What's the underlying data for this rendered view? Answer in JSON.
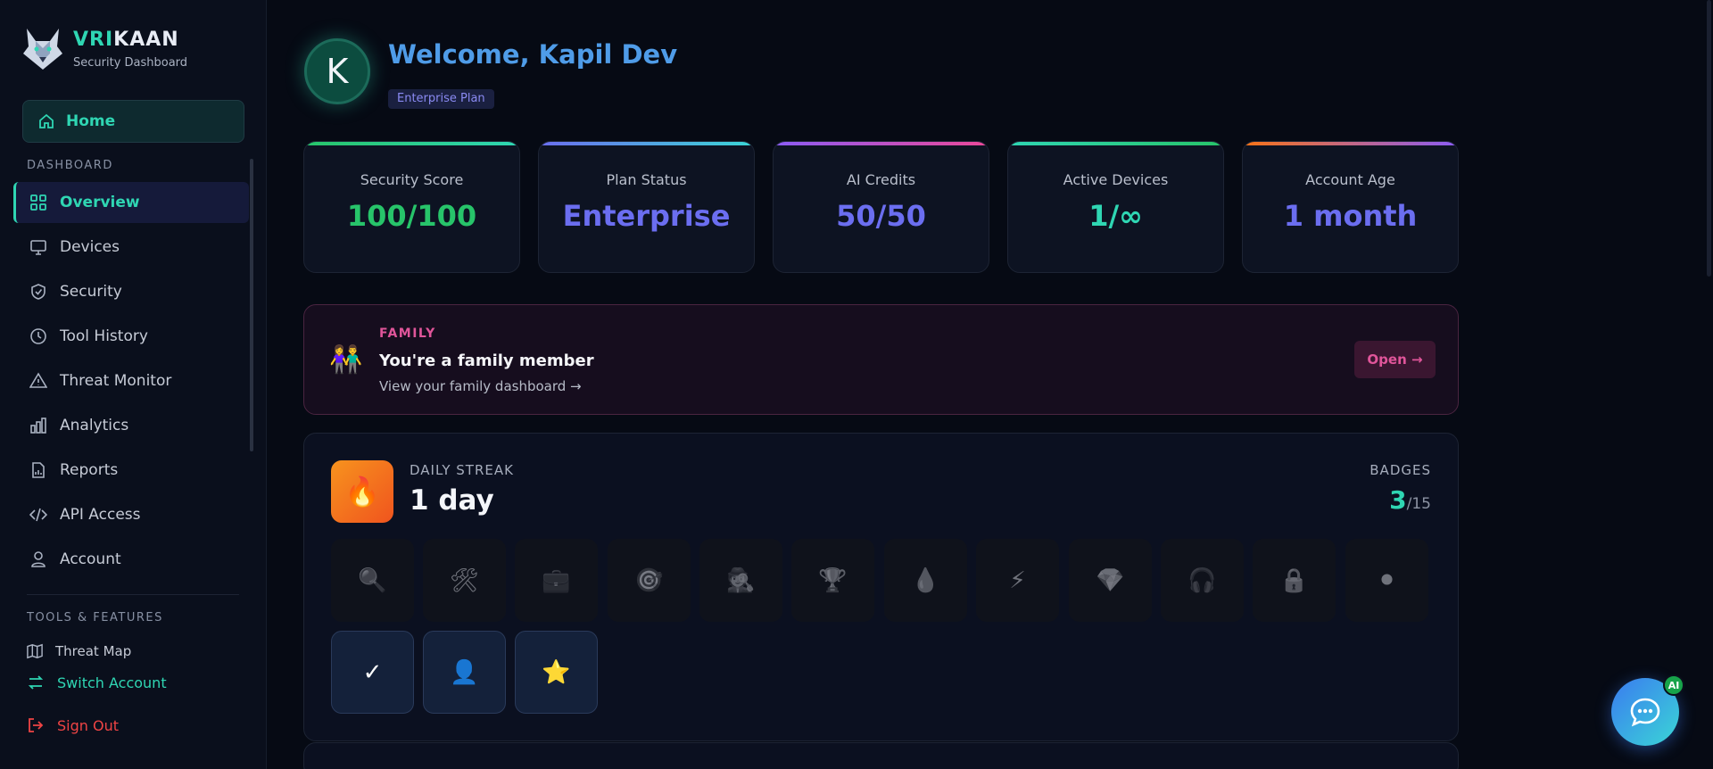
{
  "brand": {
    "name_accent": "VRI",
    "name_rest": "KAAN",
    "subtitle": "Security Dashboard"
  },
  "sidebar": {
    "home_label": "Home",
    "dashboard_section": "DASHBOARD",
    "items": [
      {
        "label": "Overview",
        "icon": "grid-icon",
        "active": true
      },
      {
        "label": "Devices",
        "icon": "monitor-icon"
      },
      {
        "label": "Security",
        "icon": "shield-check-icon"
      },
      {
        "label": "Tool History",
        "icon": "clock-icon"
      },
      {
        "label": "Threat Monitor",
        "icon": "warning-icon"
      },
      {
        "label": "Analytics",
        "icon": "bar-chart-icon"
      },
      {
        "label": "Reports",
        "icon": "report-icon"
      },
      {
        "label": "API Access",
        "icon": "code-icon"
      },
      {
        "label": "Account",
        "icon": "user-icon"
      }
    ],
    "tools_section": "TOOLS & FEATURES",
    "threat_map": "Threat Map",
    "switch_account": "Switch Account",
    "sign_out": "Sign Out"
  },
  "header": {
    "avatar_initial": "K",
    "welcome": "Welcome, Kapil Dev",
    "plan_badge": "Enterprise Plan"
  },
  "stats": [
    {
      "title": "Security Score",
      "value": "100/100",
      "color": "#27c46a",
      "bar": "linear-gradient(90deg,#27c46a,#2fd6b3)"
    },
    {
      "title": "Plan Status",
      "value": "Enterprise",
      "color": "#6b6ef0",
      "bar": "linear-gradient(90deg,#6b6ef0,#3ad6d6)"
    },
    {
      "title": "AI Credits",
      "value": "50/50",
      "color": "#6b6ef0",
      "bar": "linear-gradient(90deg,#8b5cf6,#ec4899)"
    },
    {
      "title": "Active Devices",
      "value": "1/∞",
      "color": "#2fd6b3",
      "bar": "linear-gradient(90deg,#2fd6b3,#27c46a)"
    },
    {
      "title": "Account Age",
      "value": "1 month",
      "color": "#6b6ef0",
      "bar": "linear-gradient(90deg,#f97316,#8b5cf6)"
    }
  ],
  "family": {
    "tag": "FAMILY",
    "heading": "You're a family member",
    "link": "View your family dashboard →",
    "open_label": "Open →",
    "emoji": "👫"
  },
  "streak": {
    "label": "DAILY STREAK",
    "value": "1 day",
    "badges_label": "BADGES",
    "badges_earned": "3",
    "badges_total": "/15",
    "flame": "🔥",
    "locked_badges": [
      "🔍",
      "🛠",
      "💼",
      "🎯",
      "🕵",
      "🏆",
      "💧",
      "⚡",
      "💎",
      "🎧",
      "🔒",
      "⚫"
    ],
    "earned_badges": [
      "✓",
      "👤",
      "⭐"
    ]
  },
  "chat": {
    "ai_badge": "AI"
  }
}
